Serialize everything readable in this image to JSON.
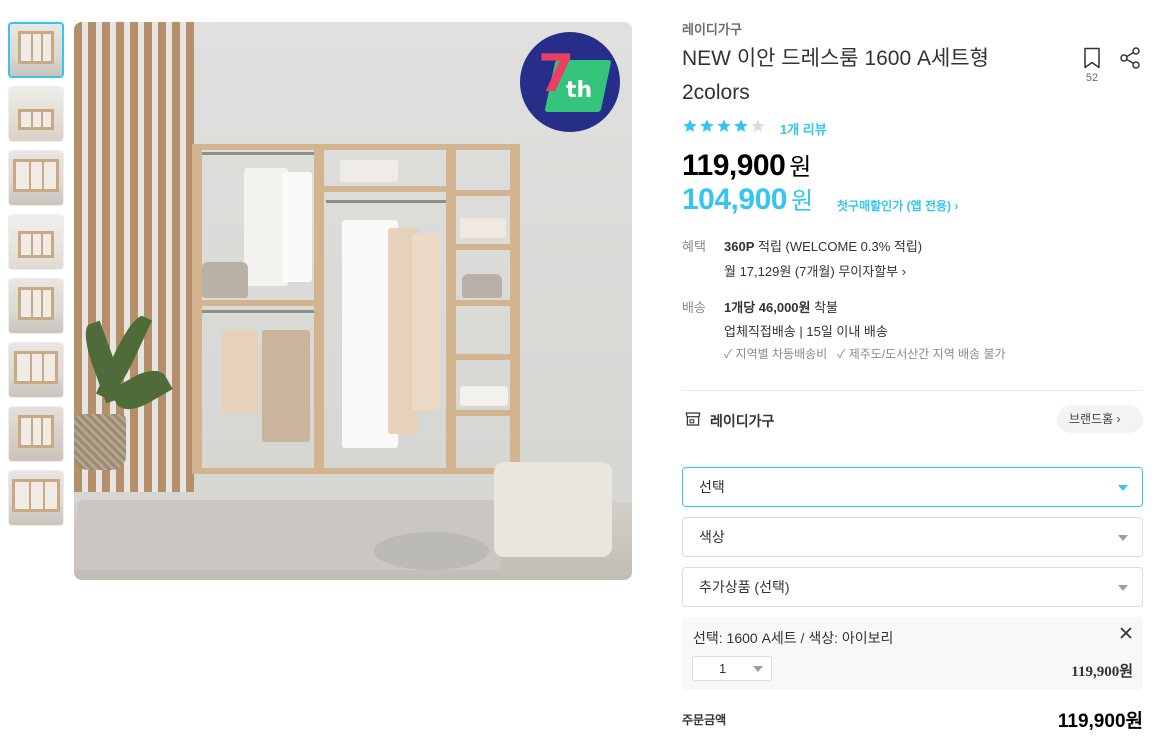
{
  "brand": "레이디가구",
  "product": {
    "title": "NEW 이안 드레스룸 1600 A세트형 2colors",
    "bookmark_count": "52",
    "rating": 4,
    "review_text": "1개 리뷰",
    "original_price": "119,900",
    "discount_price": "104,900",
    "currency": "원",
    "discount_link": "첫구매할인가 (앱 전용) ›"
  },
  "badge": {
    "number": "7",
    "suffix": "th"
  },
  "benefits": {
    "label": "혜택",
    "points_bold": "360P",
    "points_rest": " 적립 (WELCOME 0.3% 적립)",
    "installment": "월 17,129원 (7개월) 무이자할부 ›"
  },
  "delivery": {
    "label": "배송",
    "fee_bold": "1개당 46,000원",
    "fee_rest": " 착불",
    "method": "업체직접배송 | 15일 이내 배송",
    "note1": "✓ 지역별 차등배송비",
    "note2": "✓ 제주도/도서산간 지역 배송 불가"
  },
  "store": {
    "name": "레이디가구",
    "brand_home": "브랜드홈 ›"
  },
  "options": {
    "select1": "선택",
    "select2": "색상",
    "select3": "추가상품 (선택)"
  },
  "selected_option": {
    "text": "선택: 1600 A세트 / 색상: 아이보리",
    "quantity": "1",
    "price": "119,900원"
  },
  "order": {
    "label": "주문금액",
    "total": "119,900원"
  },
  "colors": {
    "accent": "#35c5f0",
    "star_empty": "#dadce0"
  },
  "thumbnails": 8
}
